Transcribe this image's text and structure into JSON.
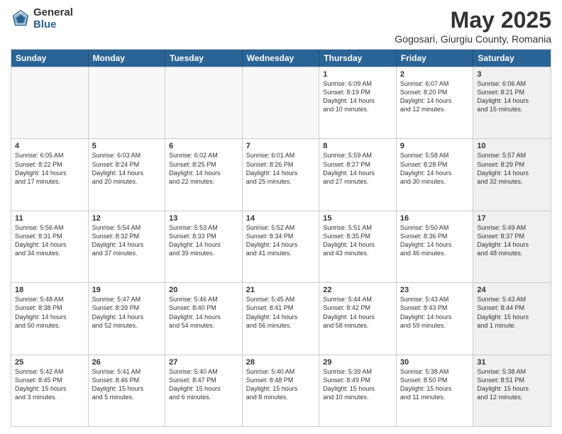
{
  "logo": {
    "general": "General",
    "blue": "Blue"
  },
  "title": "May 2025",
  "subtitle": "Gogosari, Giurgiu County, Romania",
  "days": [
    "Sunday",
    "Monday",
    "Tuesday",
    "Wednesday",
    "Thursday",
    "Friday",
    "Saturday"
  ],
  "rows": [
    [
      {
        "day": "",
        "empty": true
      },
      {
        "day": "",
        "empty": true
      },
      {
        "day": "",
        "empty": true
      },
      {
        "day": "",
        "empty": true
      },
      {
        "day": "1",
        "lines": [
          "Sunrise: 6:09 AM",
          "Sunset: 8:19 PM",
          "Daylight: 14 hours",
          "and 10 minutes."
        ]
      },
      {
        "day": "2",
        "lines": [
          "Sunrise: 6:07 AM",
          "Sunset: 8:20 PM",
          "Daylight: 14 hours",
          "and 12 minutes."
        ]
      },
      {
        "day": "3",
        "lines": [
          "Sunrise: 6:06 AM",
          "Sunset: 8:21 PM",
          "Daylight: 14 hours",
          "and 15 minutes."
        ],
        "shaded": true
      }
    ],
    [
      {
        "day": "4",
        "lines": [
          "Sunrise: 6:05 AM",
          "Sunset: 8:22 PM",
          "Daylight: 14 hours",
          "and 17 minutes."
        ]
      },
      {
        "day": "5",
        "lines": [
          "Sunrise: 6:03 AM",
          "Sunset: 8:24 PM",
          "Daylight: 14 hours",
          "and 20 minutes."
        ]
      },
      {
        "day": "6",
        "lines": [
          "Sunrise: 6:02 AM",
          "Sunset: 8:25 PM",
          "Daylight: 14 hours",
          "and 22 minutes."
        ]
      },
      {
        "day": "7",
        "lines": [
          "Sunrise: 6:01 AM",
          "Sunset: 8:26 PM",
          "Daylight: 14 hours",
          "and 25 minutes."
        ]
      },
      {
        "day": "8",
        "lines": [
          "Sunrise: 5:59 AM",
          "Sunset: 8:27 PM",
          "Daylight: 14 hours",
          "and 27 minutes."
        ]
      },
      {
        "day": "9",
        "lines": [
          "Sunrise: 5:58 AM",
          "Sunset: 8:28 PM",
          "Daylight: 14 hours",
          "and 30 minutes."
        ]
      },
      {
        "day": "10",
        "lines": [
          "Sunrise: 5:57 AM",
          "Sunset: 8:29 PM",
          "Daylight: 14 hours",
          "and 32 minutes."
        ],
        "shaded": true
      }
    ],
    [
      {
        "day": "11",
        "lines": [
          "Sunrise: 5:56 AM",
          "Sunset: 8:31 PM",
          "Daylight: 14 hours",
          "and 34 minutes."
        ]
      },
      {
        "day": "12",
        "lines": [
          "Sunrise: 5:54 AM",
          "Sunset: 8:32 PM",
          "Daylight: 14 hours",
          "and 37 minutes."
        ]
      },
      {
        "day": "13",
        "lines": [
          "Sunrise: 5:53 AM",
          "Sunset: 8:33 PM",
          "Daylight: 14 hours",
          "and 39 minutes."
        ]
      },
      {
        "day": "14",
        "lines": [
          "Sunrise: 5:52 AM",
          "Sunset: 8:34 PM",
          "Daylight: 14 hours",
          "and 41 minutes."
        ]
      },
      {
        "day": "15",
        "lines": [
          "Sunrise: 5:51 AM",
          "Sunset: 8:35 PM",
          "Daylight: 14 hours",
          "and 43 minutes."
        ]
      },
      {
        "day": "16",
        "lines": [
          "Sunrise: 5:50 AM",
          "Sunset: 8:36 PM",
          "Daylight: 14 hours",
          "and 46 minutes."
        ]
      },
      {
        "day": "17",
        "lines": [
          "Sunrise: 5:49 AM",
          "Sunset: 8:37 PM",
          "Daylight: 14 hours",
          "and 48 minutes."
        ],
        "shaded": true
      }
    ],
    [
      {
        "day": "18",
        "lines": [
          "Sunrise: 5:48 AM",
          "Sunset: 8:38 PM",
          "Daylight: 14 hours",
          "and 50 minutes."
        ]
      },
      {
        "day": "19",
        "lines": [
          "Sunrise: 5:47 AM",
          "Sunset: 8:39 PM",
          "Daylight: 14 hours",
          "and 52 minutes."
        ]
      },
      {
        "day": "20",
        "lines": [
          "Sunrise: 5:46 AM",
          "Sunset: 8:40 PM",
          "Daylight: 14 hours",
          "and 54 minutes."
        ]
      },
      {
        "day": "21",
        "lines": [
          "Sunrise: 5:45 AM",
          "Sunset: 8:41 PM",
          "Daylight: 14 hours",
          "and 56 minutes."
        ]
      },
      {
        "day": "22",
        "lines": [
          "Sunrise: 5:44 AM",
          "Sunset: 8:42 PM",
          "Daylight: 14 hours",
          "and 58 minutes."
        ]
      },
      {
        "day": "23",
        "lines": [
          "Sunrise: 5:43 AM",
          "Sunset: 8:43 PM",
          "Daylight: 14 hours",
          "and 59 minutes."
        ]
      },
      {
        "day": "24",
        "lines": [
          "Sunrise: 5:43 AM",
          "Sunset: 8:44 PM",
          "Daylight: 15 hours",
          "and 1 minute."
        ],
        "shaded": true
      }
    ],
    [
      {
        "day": "25",
        "lines": [
          "Sunrise: 5:42 AM",
          "Sunset: 8:45 PM",
          "Daylight: 15 hours",
          "and 3 minutes."
        ]
      },
      {
        "day": "26",
        "lines": [
          "Sunrise: 5:41 AM",
          "Sunset: 8:46 PM",
          "Daylight: 15 hours",
          "and 5 minutes."
        ]
      },
      {
        "day": "27",
        "lines": [
          "Sunrise: 5:40 AM",
          "Sunset: 8:47 PM",
          "Daylight: 15 hours",
          "and 6 minutes."
        ]
      },
      {
        "day": "28",
        "lines": [
          "Sunrise: 5:40 AM",
          "Sunset: 8:48 PM",
          "Daylight: 15 hours",
          "and 8 minutes."
        ]
      },
      {
        "day": "29",
        "lines": [
          "Sunrise: 5:39 AM",
          "Sunset: 8:49 PM",
          "Daylight: 15 hours",
          "and 10 minutes."
        ]
      },
      {
        "day": "30",
        "lines": [
          "Sunrise: 5:38 AM",
          "Sunset: 8:50 PM",
          "Daylight: 15 hours",
          "and 11 minutes."
        ]
      },
      {
        "day": "31",
        "lines": [
          "Sunrise: 5:38 AM",
          "Sunset: 8:51 PM",
          "Daylight: 15 hours",
          "and 12 minutes."
        ],
        "shaded": true
      }
    ]
  ]
}
